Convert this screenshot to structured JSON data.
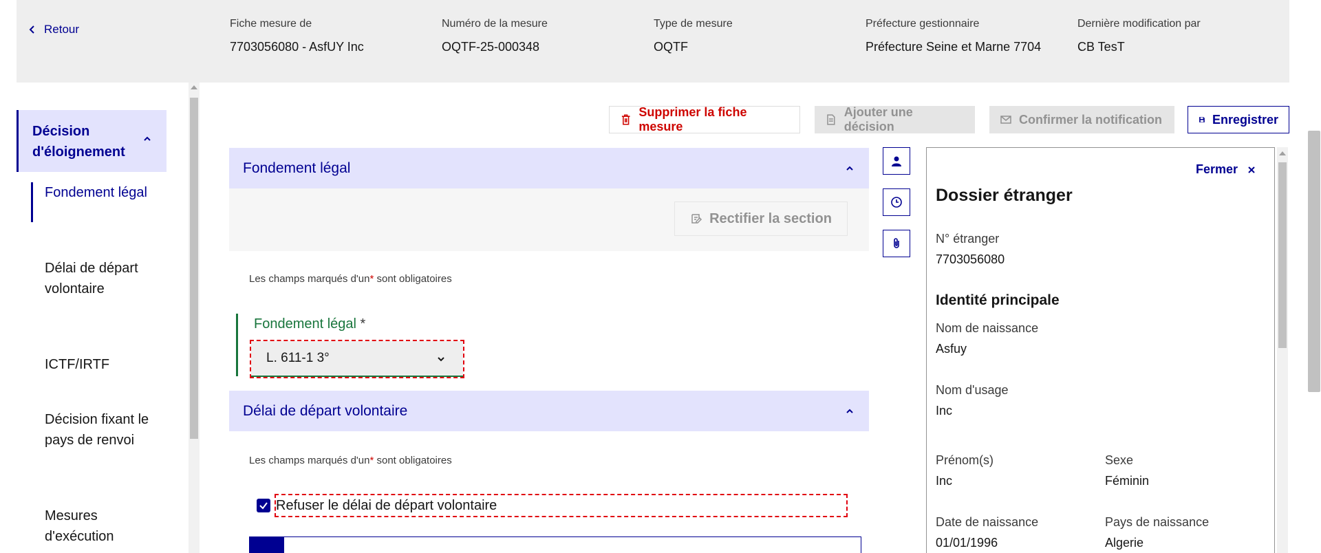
{
  "header": {
    "back_label": "Retour",
    "columns": [
      {
        "label": "Fiche mesure de",
        "value": "7703056080 - AsfUY Inc"
      },
      {
        "label": "Numéro de la mesure",
        "value": "OQTF-25-000348"
      },
      {
        "label": "Type de mesure",
        "value": "OQTF"
      },
      {
        "label": "Préfecture gestionnaire",
        "value": "Préfecture Seine et Marne 7704"
      },
      {
        "label": "Dernière modification par",
        "value": "CB TesT"
      }
    ]
  },
  "sidebar": {
    "section_title": "Décision d'éloignement",
    "items": [
      {
        "label": "Fondement légal"
      },
      {
        "label": "Délai de départ volontaire"
      },
      {
        "label": "ICTF/IRTF"
      },
      {
        "label": "Décision fixant le pays de renvoi"
      },
      {
        "label": "Mesures d'exécution"
      }
    ]
  },
  "toolbar": {
    "delete_label": "Supprimer la fiche mesure",
    "add_decision_label": "Ajouter une décision",
    "confirm_notification_label": "Confirmer la notification",
    "save_label": "Enregistrer"
  },
  "sections": {
    "fondement": {
      "title": "Fondement légal",
      "rectify_label": "Rectifier la section",
      "mandatory_prefix": "Les champs marqués d'un",
      "mandatory_star": "*",
      "mandatory_suffix": "sont obligatoires",
      "field_label": "Fondement légal",
      "field_star": "*",
      "select_value": "L. 611-1 3°"
    },
    "delai": {
      "title": "Délai de départ volontaire",
      "mandatory_prefix": "Les champs marqués d'un",
      "mandatory_star": "*",
      "mandatory_suffix": "sont obligatoires",
      "checkbox_label": "Refuser le délai de départ volontaire",
      "checkbox_checked": true
    }
  },
  "side_icons": [
    "person-icon",
    "clock-icon",
    "paperclip-icon"
  ],
  "dossier": {
    "close_label": "Fermer",
    "title": "Dossier étranger",
    "numero_label": "N° étranger",
    "numero_value": "7703056080",
    "identity_title": "Identité principale",
    "nom_naissance_label": "Nom de naissance",
    "nom_naissance_value": "Asfuy",
    "nom_usage_label": "Nom d'usage",
    "nom_usage_value": "Inc",
    "prenom_label": "Prénom(s)",
    "prenom_value": "Inc",
    "sexe_label": "Sexe",
    "sexe_value": "Féminin",
    "date_naissance_label": "Date de naissance",
    "date_naissance_value": "01/01/1996",
    "pays_naissance_label": "Pays de naissance",
    "pays_naissance_value": "Algerie"
  },
  "colors": {
    "primary": "#000091",
    "danger": "#ce0500",
    "success": "#18753c",
    "accent_bg": "#e3e3fd"
  }
}
